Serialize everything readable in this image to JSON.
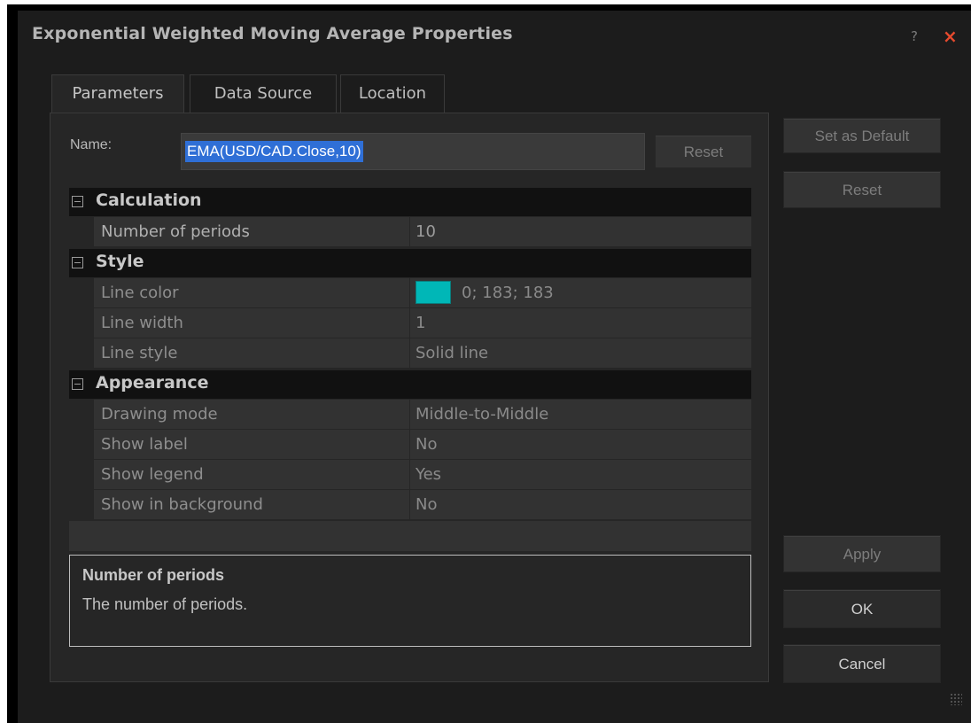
{
  "window": {
    "title": "Exponential Weighted Moving Average Properties",
    "help_glyph": "?",
    "close_glyph": "×"
  },
  "tabs": [
    {
      "label": "Parameters",
      "active": true
    },
    {
      "label": "Data Source",
      "active": false
    },
    {
      "label": "Location",
      "active": false
    }
  ],
  "name_field": {
    "label": "Name:",
    "value": "EMA(USD/CAD.Close,10)",
    "reset_label": "Reset"
  },
  "side_buttons": {
    "set_default": "Set as Default",
    "reset": "Reset",
    "apply": "Apply",
    "ok": "OK",
    "cancel": "Cancel"
  },
  "sections": {
    "calculation": {
      "title": "Calculation",
      "rows": [
        {
          "key": "Number of periods",
          "value": "10"
        }
      ]
    },
    "style": {
      "title": "Style",
      "rows": [
        {
          "key": "Line color",
          "value": "0; 183; 183",
          "color": "#00b7b7"
        },
        {
          "key": "Line width",
          "value": "1"
        },
        {
          "key": "Line style",
          "value": "Solid line"
        }
      ]
    },
    "appearance": {
      "title": "Appearance",
      "rows": [
        {
          "key": "Drawing mode",
          "value": "Middle-to-Middle"
        },
        {
          "key": "Show label",
          "value": "No"
        },
        {
          "key": "Show legend",
          "value": "Yes"
        },
        {
          "key": "Show in background",
          "value": "No"
        }
      ]
    }
  },
  "description": {
    "title": "Number of periods",
    "text": "The number of periods."
  }
}
